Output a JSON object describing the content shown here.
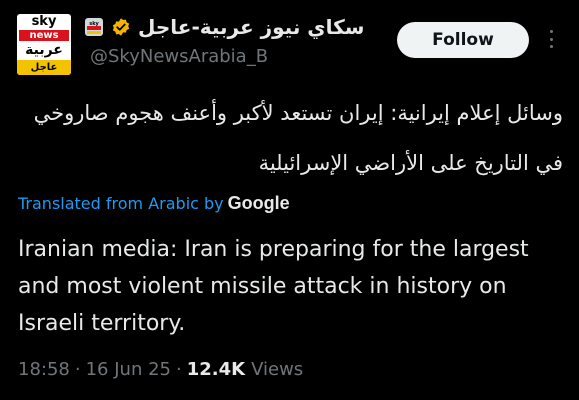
{
  "account": {
    "display_name": "سكاي نيوز عربية-عاجل",
    "handle": "@SkyNewsArabia_B",
    "avatar": {
      "line1": "sky",
      "line2": "news",
      "line3": "عربية",
      "line4": "عاجل"
    },
    "verified_color": "#f4b400"
  },
  "actions": {
    "follow_label": "Follow",
    "more_icon": "more-vertical-icon"
  },
  "tweet": {
    "original_text": "وسائل إعلام إيرانية: إيران تستعد لأكبر وأعنف هجوم صاروخي في التاريخ على الأراضي الإسرائيلية",
    "translated_from": "Translated from Arabic by",
    "translator": "Google",
    "translated_text": "Iranian media: Iran is preparing for the largest and most violent missile attack in history on Israeli territory."
  },
  "meta": {
    "time": "18:58",
    "separator": "·",
    "date": "16 Jun 25",
    "views_count": "12.4K",
    "views_label": "Views"
  },
  "colors": {
    "background": "#000000",
    "link": "#1d9bf0",
    "muted": "#71767b",
    "text": "#e7e9ea",
    "brand_red": "#d9131e",
    "brand_yellow": "#f3c300"
  }
}
